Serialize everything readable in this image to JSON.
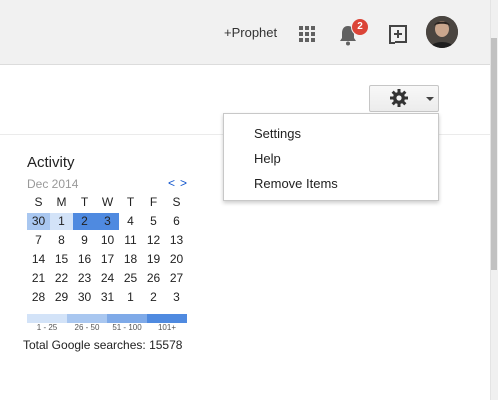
{
  "header": {
    "user_link": "+Prophet",
    "notification_count": "2"
  },
  "settings_menu": {
    "items": [
      "Settings",
      "Help",
      "Remove Items"
    ]
  },
  "activity": {
    "title": "Activity",
    "month": "Dec 2014",
    "prev": "<",
    "next": ">",
    "weekdays": [
      "S",
      "M",
      "T",
      "W",
      "T",
      "F",
      "S"
    ],
    "weeks": [
      [
        "30",
        "1",
        "2",
        "3",
        "4",
        "5",
        "6"
      ],
      [
        "7",
        "8",
        "9",
        "10",
        "11",
        "12",
        "13"
      ],
      [
        "14",
        "15",
        "16",
        "17",
        "18",
        "19",
        "20"
      ],
      [
        "21",
        "22",
        "23",
        "24",
        "25",
        "26",
        "27"
      ],
      [
        "28",
        "29",
        "30",
        "31",
        "1",
        "2",
        "3"
      ]
    ],
    "highlighted": [
      {
        "week": 0,
        "day": 0,
        "level": 2
      },
      {
        "week": 0,
        "day": 1,
        "level": 1
      },
      {
        "week": 0,
        "day": 2,
        "level": 3
      },
      {
        "week": 0,
        "day": 3,
        "level": 3
      }
    ],
    "legend": [
      {
        "label": "1 - 25",
        "color": "#d3e3f8"
      },
      {
        "label": "26 - 50",
        "color": "#a9c7f0"
      },
      {
        "label": "51 - 100",
        "color": "#7faae8"
      },
      {
        "label": "101+",
        "color": "#4f8ae0"
      }
    ],
    "total_label": "Total Google searches: 15578"
  },
  "colors": {
    "level1": "#d3e3f8",
    "level2": "#a9c7f0",
    "level3": "#4f8ae0",
    "badge": "#db4437"
  }
}
